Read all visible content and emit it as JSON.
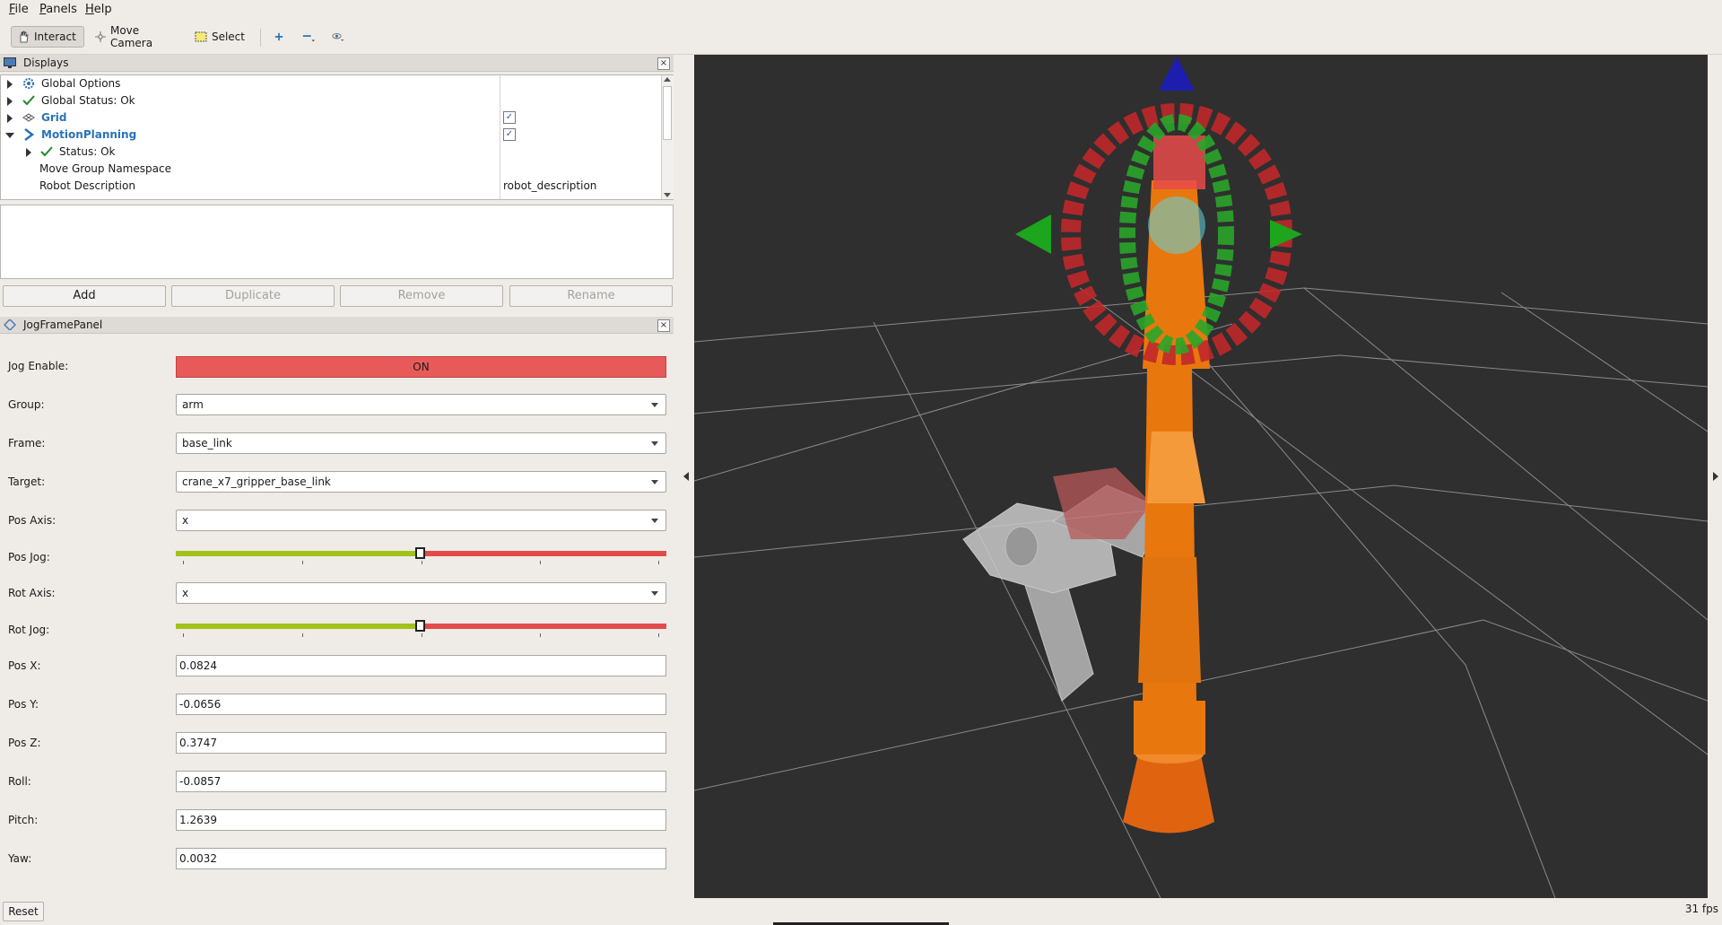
{
  "menubar": {
    "items": [
      "File",
      "Panels",
      "Help"
    ]
  },
  "toolbar": {
    "interact_label": "Interact",
    "move_camera_label": "Move Camera",
    "select_label": "Select"
  },
  "displays": {
    "title": "Displays",
    "tree": [
      {
        "label": "Global Options",
        "value": ""
      },
      {
        "label": "Global Status: Ok",
        "value": ""
      },
      {
        "label": "Grid",
        "value": ""
      },
      {
        "label": "MotionPlanning",
        "value": ""
      },
      {
        "label": "Status: Ok",
        "value": ""
      },
      {
        "label": "Move Group Namespace",
        "value": ""
      },
      {
        "label": "Robot Description",
        "value": "robot_description"
      }
    ],
    "buttons": {
      "add": "Add",
      "duplicate": "Duplicate",
      "remove": "Remove",
      "rename": "Rename"
    }
  },
  "jog": {
    "title": "JogFramePanel",
    "jog_enable_label": "Jog Enable:",
    "jog_enable_value": "ON",
    "group_label": "Group:",
    "group_value": "arm",
    "frame_label": "Frame:",
    "frame_value": "base_link",
    "target_label": "Target:",
    "target_value": "crane_x7_gripper_base_link",
    "pos_axis_label": "Pos Axis:",
    "pos_axis_value": "x",
    "pos_jog_label": "Pos Jog:",
    "pos_jog_level": 0.5,
    "rot_axis_label": "Rot Axis:",
    "rot_axis_value": "x",
    "rot_jog_label": "Rot Jog:",
    "rot_jog_level": 0.5,
    "pos_x_label": "Pos X:",
    "pos_x_value": "0.0824",
    "pos_y_label": "Pos Y:",
    "pos_y_value": "-0.0656",
    "pos_z_label": "Pos Z:",
    "pos_z_value": "0.3747",
    "roll_label": "Roll:",
    "roll_value": "-0.0857",
    "pitch_label": "Pitch:",
    "pitch_value": "1.2639",
    "yaw_label": "Yaw:",
    "yaw_value": "0.0032",
    "reset_label": "Reset"
  },
  "status": {
    "fps": "31 fps"
  },
  "colors": {
    "toggle_on": "#e85a5a",
    "slider_left": "#a1c21a",
    "slider_right": "#e24b4b",
    "robot_orange": "#e8780e",
    "viewport_bg": "#2f2f2f"
  }
}
